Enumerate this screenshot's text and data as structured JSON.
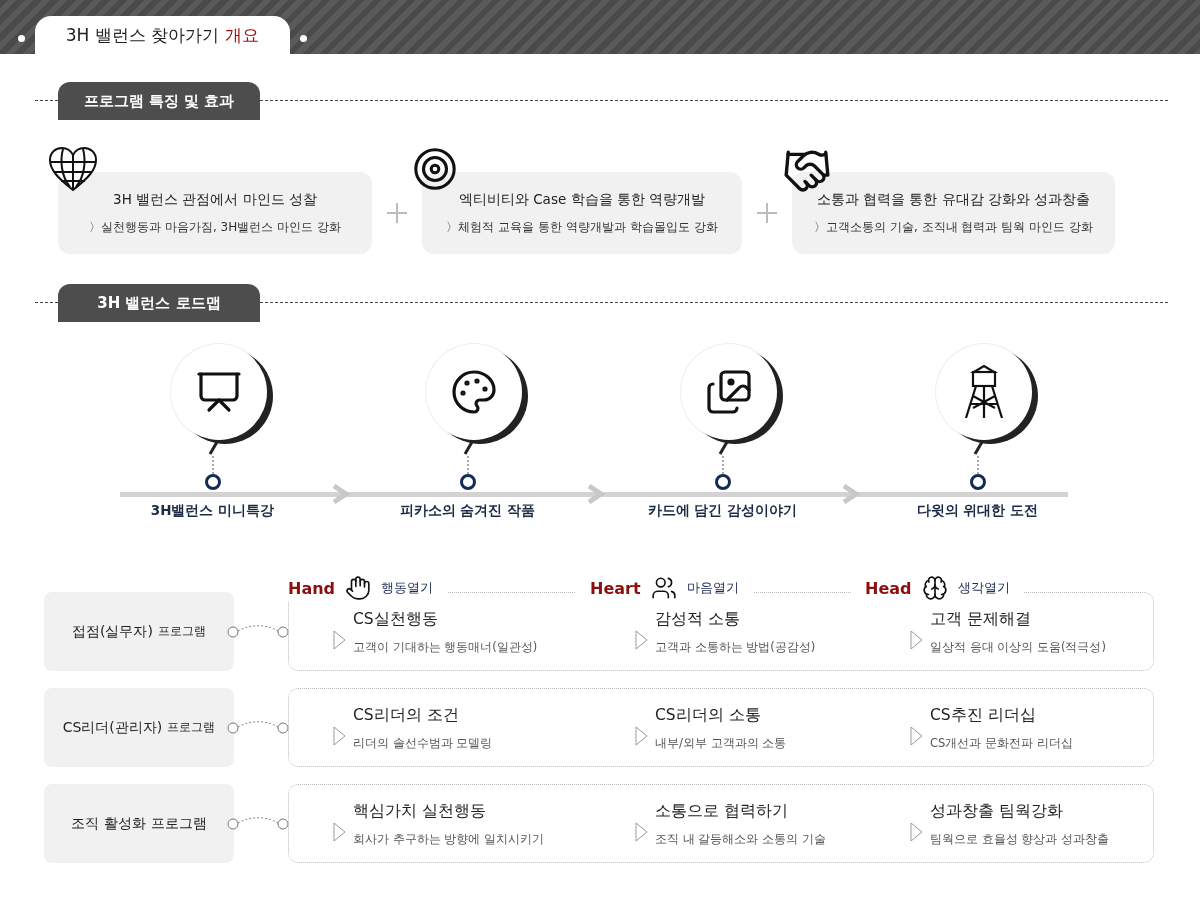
{
  "header": {
    "title": "3H 밸런스 찾아가기",
    "highlight": "개요"
  },
  "features_section": {
    "heading": "프로그램 특징 및 효과",
    "features": [
      {
        "kind": "heart",
        "title": "3H 밸런스 관점에서 마인드 성찰",
        "detail": "〉실천행동과 마음가짐, 3H밸런스 마인드 강화"
      },
      {
        "kind": "target",
        "title": "엑티비티와 Case 학습을 통한 역량개발",
        "detail": "〉체험적 교육을 통한 역량개발과 학습몰입도 강화"
      },
      {
        "kind": "handshake",
        "title": "소통과 협력을 통한 유대감 강화와 성과창출",
        "detail": "〉고객소통의 기술, 조직내 협력과 팀웍 마인드 강화"
      }
    ]
  },
  "roadmap": {
    "heading": "3H 밸런스 로드맵",
    "steps": [
      {
        "kind": "presenter",
        "label": "3H밸런스 미니특강"
      },
      {
        "kind": "palette",
        "label": "피카소의 숨겨진 작품"
      },
      {
        "kind": "pictures",
        "label": "카드에 담긴 감성이야기"
      },
      {
        "kind": "tower",
        "label": "다윗의 위대한 도전"
      }
    ]
  },
  "programs": {
    "columns": [
      {
        "kind": "hand",
        "english": "Hand",
        "korean": "행동열기"
      },
      {
        "kind": "heart",
        "english": "Heart",
        "korean": "마음열기"
      },
      {
        "kind": "head",
        "english": "Head",
        "korean": "생각열기"
      }
    ],
    "rows": [
      {
        "name": "접점(실무자)",
        "suffix": "프로그램",
        "suffix_small": true,
        "items": [
          {
            "title": "CS실천행동",
            "detail": "고객이 기대하는 행동매너(일관성)"
          },
          {
            "title": "감성적 소통",
            "detail": "고객과 소통하는 방법(공감성)"
          },
          {
            "title": "고객 문제해결",
            "detail": "일상적 응대 이상의 도움(적극성)"
          }
        ]
      },
      {
        "name": "CS리더(관리자)",
        "suffix": "프로그램",
        "suffix_small": true,
        "items": [
          {
            "title": "CS리더의 조건",
            "detail": "리더의 솔선수범과 모델링"
          },
          {
            "title": "CS리더의 소통",
            "detail": "내부/외부 고객과의 소통"
          },
          {
            "title": "CS추진 리더십",
            "detail": "CS개선과 문화전파 리더십"
          }
        ]
      },
      {
        "name": "조직 활성화",
        "suffix": "프로그램",
        "suffix_small": false,
        "items": [
          {
            "title": "핵심가치 실천행동",
            "detail": "회사가 추구하는 방향에 일치시키기"
          },
          {
            "title": "소통으로 협력하기",
            "detail": "조직 내  갈등해소와 소통의 기술"
          },
          {
            "title": "성과창출  팀웍강화",
            "detail": "팀웍으로 효율성 향상과 성과창출"
          }
        ]
      }
    ]
  }
}
